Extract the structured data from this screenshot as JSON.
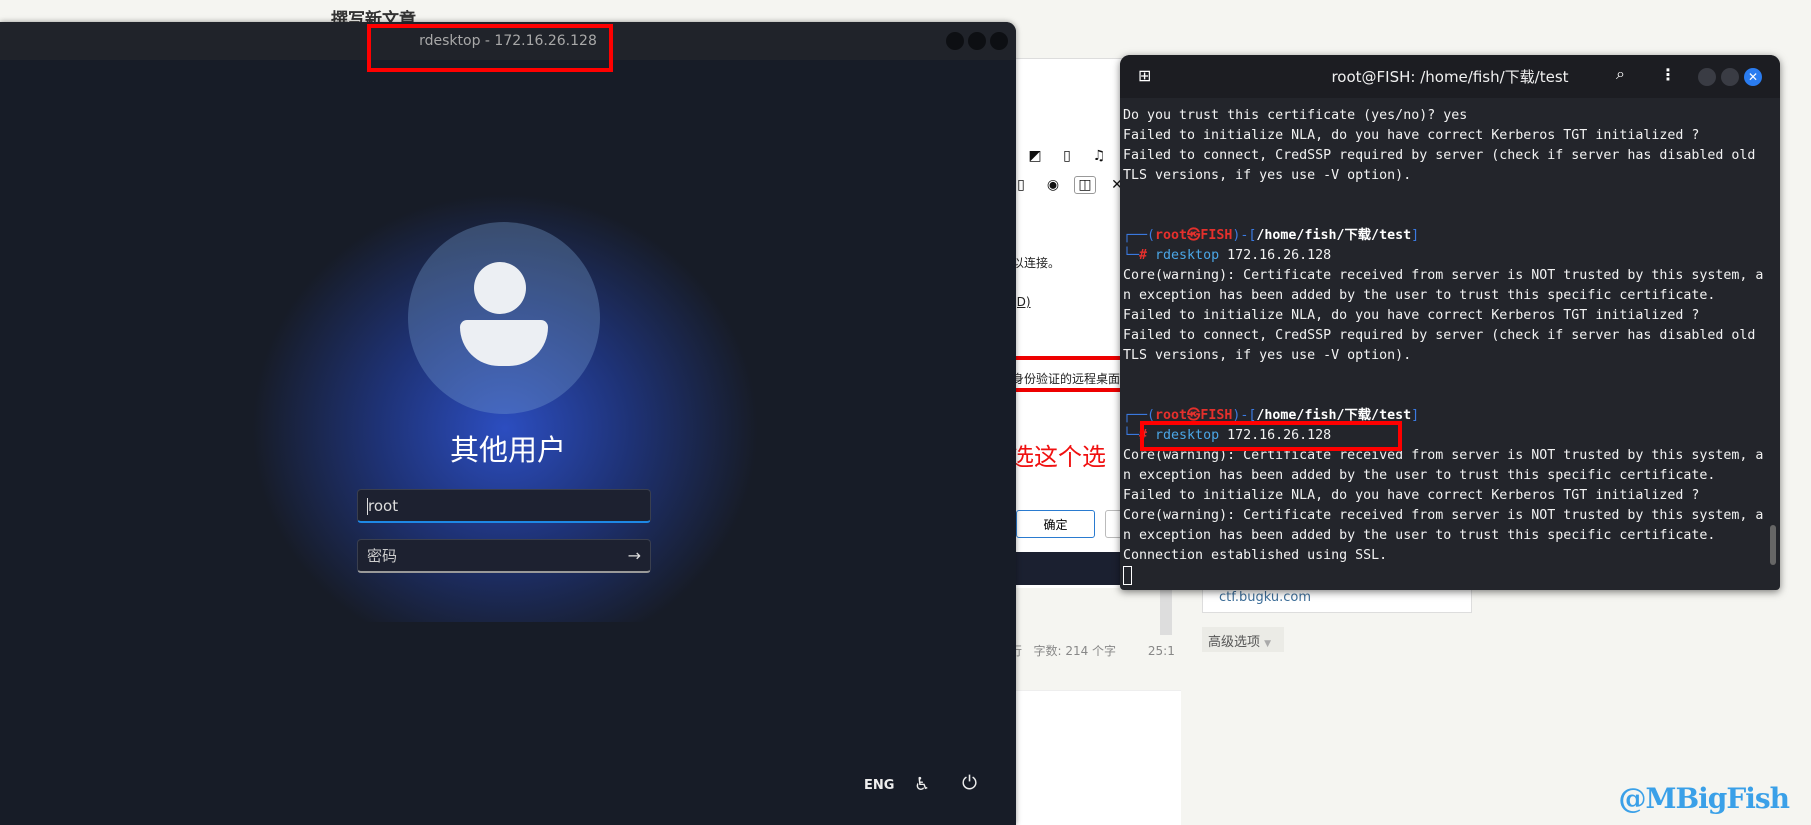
{
  "background_page": {
    "title": "撰写新文章",
    "fragments": {
      "connect": "以连接。",
      "d_link": "(D)",
      "nla_option": "身份验证的远程桌面的计算",
      "annotation": "选这个选"
    },
    "buttons": {
      "ok": "确定",
      "cancel": ""
    },
    "status": {
      "line": "行",
      "word_count": "字数: 214 个字",
      "position": "25:1"
    },
    "url": "ctf.bugku.com",
    "advanced": "高级选项",
    "watermark": "@MBigFish"
  },
  "rdesktop": {
    "title": "rdesktop - 172.16.26.128",
    "login": {
      "user_label": "其他用户",
      "username_value": "root",
      "password_placeholder": "密码"
    },
    "footer": {
      "language": "ENG"
    }
  },
  "terminal": {
    "title": "root@FISH: /home/fish/下载/test",
    "prompt": {
      "box_top": "┌──(",
      "user": "root㉿FISH",
      "close": ")-[",
      "path": "/home/fish/下载/test",
      "bracket_end": "]",
      "box_bottom": "└─",
      "hash": "# ",
      "cmd": "rdesktop",
      "arg": " 172.16.26.128"
    },
    "block1": [
      "Do you trust this certificate (yes/no)? yes",
      "Failed to initialize NLA, do you have correct Kerberos TGT initialized ?",
      "Failed to connect, CredSSP required by server (check if server has disabled old",
      "TLS versions, if yes use -V option)."
    ],
    "block2": [
      "Core(warning): Certificate received from server is NOT trusted by this system, a",
      "n exception has been added by the user to trust this specific certificate.",
      "Failed to initialize NLA, do you have correct Kerberos TGT initialized ?",
      "Failed to connect, CredSSP required by server (check if server has disabled old",
      "TLS versions, if yes use -V option)."
    ],
    "block3": [
      "Core(warning): Certificate received from server is NOT trusted by this system, a",
      "n exception has been added by the user to trust this specific certificate.",
      "Failed to initialize NLA, do you have correct Kerberos TGT initialized ?",
      "Core(warning): Certificate received from server is NOT trusted by this system, a",
      "n exception has been added by the user to trust this specific certificate.",
      "Connection established using SSL."
    ]
  },
  "colors": {
    "annotation_red": "#ff0000",
    "terminal_bg": "#23252b",
    "accent_blue": "#1e88e5",
    "prompt_red": "#e5302c"
  }
}
